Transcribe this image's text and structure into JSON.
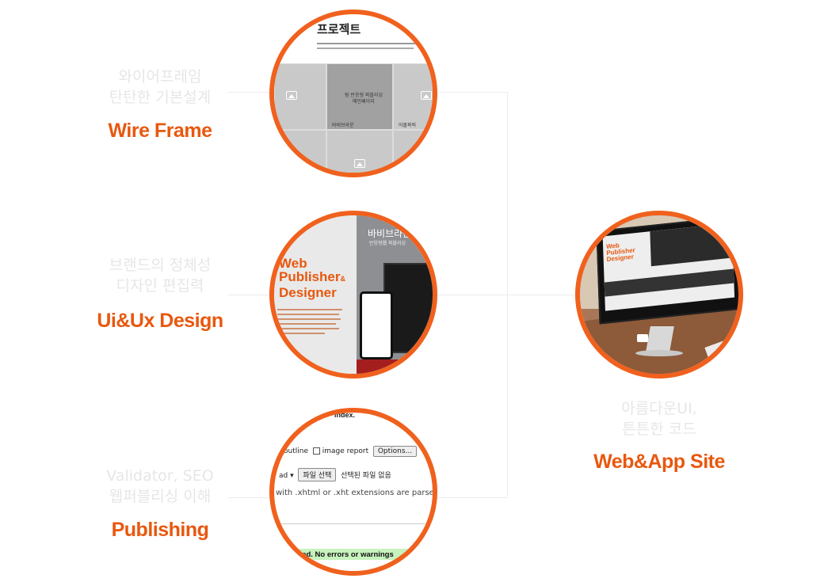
{
  "sections": [
    {
      "id": "wireframe",
      "caption_line1": "와이어프레임",
      "caption_line2": "탄탄한 기본설계",
      "title": "Wire Frame"
    },
    {
      "id": "design",
      "caption_line1": "브랜드의 정체성",
      "caption_line2": "디자인 편집력",
      "title": "Ui&Ux Design"
    },
    {
      "id": "publishing",
      "caption_line1": "Validator, SEO",
      "caption_line2": "웹퍼블리싱 이해",
      "title": "Publishing"
    },
    {
      "id": "webapp",
      "caption_line1": "아름다운UI,",
      "caption_line2": "튼튼한 코드",
      "title": "Web&App Site"
    }
  ],
  "wireframe_shot": {
    "heading": "프로젝트",
    "center_label": "팀 반응형 퍼블리싱",
    "center_sub": "메인페이지",
    "label_left": "바비브라운",
    "label_right": "아몰퍼릭"
  },
  "design_shot": {
    "line1": "Web",
    "line2": "Publisher",
    "amp": "&",
    "line3": "Designer",
    "brand": "바비브라운",
    "brand_sub": "반응형웹 퍼블리싱"
  },
  "publishing_shot": {
    "file_label": "index.",
    "outline_label": "outline",
    "image_report_label": "image report",
    "options_button": "Options...",
    "select_value": "ad",
    "file_button": "파일 선택",
    "no_file": "선택된 파일 없음",
    "parse_note": "with .xhtml or .xht extensions are parsed",
    "result": "ted. No errors or warnings"
  },
  "webapp_shot": {
    "screen_line1": "Web",
    "screen_line2": "Publisher",
    "screen_line3": "Designer"
  },
  "colors": {
    "accent": "#e8580f",
    "caption": "#e6e6e6",
    "line": "#ececec"
  }
}
